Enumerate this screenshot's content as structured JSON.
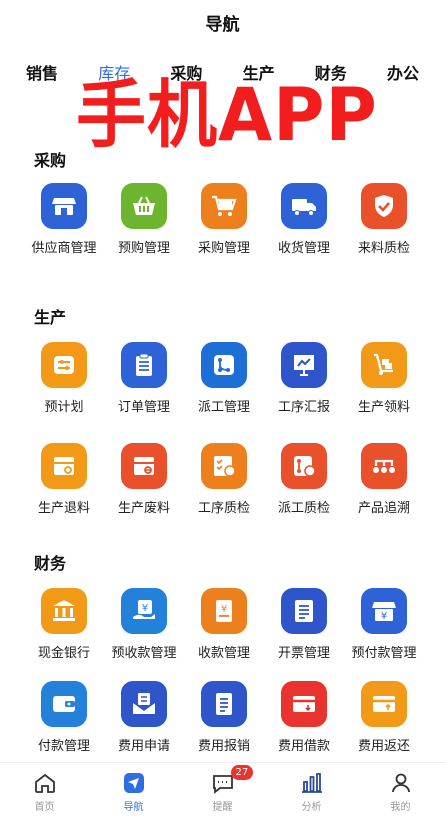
{
  "header": {
    "title": "导航"
  },
  "tabs": [
    {
      "label": "销售",
      "active": false
    },
    {
      "label": "库存",
      "active": true
    },
    {
      "label": "采购",
      "active": false
    },
    {
      "label": "生产",
      "active": false
    },
    {
      "label": "财务",
      "active": false
    },
    {
      "label": "办公",
      "active": false
    }
  ],
  "banner": {
    "text": "手机APP",
    "color": "#f21d1d"
  },
  "sections": {
    "purchase": {
      "title": "采购",
      "items": [
        {
          "label": "供应商管理",
          "icon": "store-icon",
          "color": "#2e63d8"
        },
        {
          "label": "预购管理",
          "icon": "basket-icon",
          "color": "#6db52f"
        },
        {
          "label": "采购管理",
          "icon": "cart-icon",
          "color": "#ee7f1d"
        },
        {
          "label": "收货管理",
          "icon": "truck-icon",
          "color": "#2e63d8"
        },
        {
          "label": "来料质检",
          "icon": "shield-check-icon",
          "color": "#e8512a"
        }
      ]
    },
    "production": {
      "title": "生产",
      "items": [
        {
          "label": "预计划",
          "icon": "sliders-icon",
          "color": "#f29a17"
        },
        {
          "label": "订单管理",
          "icon": "clipboard-icon",
          "color": "#2e63d8"
        },
        {
          "label": "派工管理",
          "icon": "flow-icon",
          "color": "#1d6fd6"
        },
        {
          "label": "工序汇报",
          "icon": "presentation-icon",
          "color": "#2e55c9"
        },
        {
          "label": "生产领料",
          "icon": "hand-truck-icon",
          "color": "#f29a17"
        },
        {
          "label": "生产退料",
          "icon": "return-box-icon",
          "color": "#f29a17"
        },
        {
          "label": "生产废料",
          "icon": "waste-box-icon",
          "color": "#e8512a"
        },
        {
          "label": "工序质检",
          "icon": "checklist-icon",
          "color": "#ee7f1d"
        },
        {
          "label": "派工质检",
          "icon": "flow-check-icon",
          "color": "#e8512a"
        },
        {
          "label": "产品追溯",
          "icon": "trace-icon",
          "color": "#e8512a"
        }
      ]
    },
    "finance": {
      "title": "财务",
      "items": [
        {
          "label": "现金银行",
          "icon": "bank-icon",
          "color": "#f29a17"
        },
        {
          "label": "预收款管理",
          "icon": "hand-money-icon",
          "color": "#2381d9"
        },
        {
          "label": "收款管理",
          "icon": "receipt-yen-icon",
          "color": "#ee7f1d"
        },
        {
          "label": "开票管理",
          "icon": "invoice-icon",
          "color": "#2e55c9"
        },
        {
          "label": "预付款管理",
          "icon": "store-yen-icon",
          "color": "#2e63d8"
        },
        {
          "label": "付款管理",
          "icon": "wallet-icon",
          "color": "#2381d9"
        },
        {
          "label": "费用申请",
          "icon": "envelope-icon",
          "color": "#2e55c9"
        },
        {
          "label": "费用报销",
          "icon": "receipt-icon",
          "color": "#2e55c9"
        },
        {
          "label": "费用借款",
          "icon": "card-out-icon",
          "color": "#e8332f"
        },
        {
          "label": "费用返还",
          "icon": "card-in-icon",
          "color": "#f29a17"
        }
      ]
    }
  },
  "bottom_nav": [
    {
      "label": "首页",
      "icon": "home-icon",
      "active": false
    },
    {
      "label": "导航",
      "icon": "navigation-icon",
      "active": true
    },
    {
      "label": "提醒",
      "icon": "message-icon",
      "active": false,
      "badge": "27"
    },
    {
      "label": "分析",
      "icon": "bar-chart-icon",
      "active": false
    },
    {
      "label": "我的",
      "icon": "user-icon",
      "active": false
    }
  ]
}
